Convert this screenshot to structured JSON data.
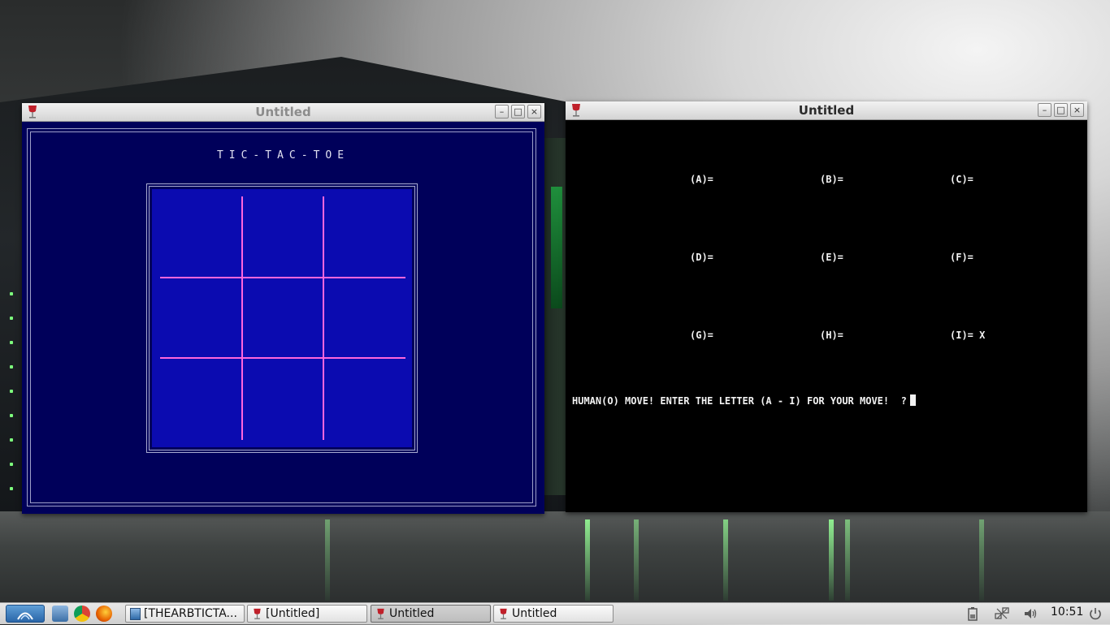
{
  "game_window": {
    "title": "Untitled",
    "heading": "TIC-TAC-TOE",
    "buttons": {
      "minimize": "–",
      "maximize": "□",
      "close": "×"
    }
  },
  "console_window": {
    "title": "Untitled",
    "buttons": {
      "minimize": "–",
      "maximize": "□",
      "close": "×"
    },
    "cells": [
      {
        "label": "(A)=",
        "value": ""
      },
      {
        "label": "(B)=",
        "value": ""
      },
      {
        "label": "(C)=",
        "value": ""
      },
      {
        "label": "(D)=",
        "value": ""
      },
      {
        "label": "(E)=",
        "value": ""
      },
      {
        "label": "(F)=",
        "value": ""
      },
      {
        "label": "(G)=",
        "value": ""
      },
      {
        "label": "(H)=",
        "value": ""
      },
      {
        "label": "(I)=",
        "value": "X"
      }
    ],
    "prompt": "HUMAN(O) MOVE! ENTER THE LETTER (A - I) FOR YOUR MOVE!  ?"
  },
  "taskbar": {
    "tasks": [
      {
        "label": "[THEARBTICTA...",
        "icon": "window-icon"
      },
      {
        "label": "[Untitled]",
        "icon": "wine-icon"
      },
      {
        "label": "Untitled",
        "icon": "wine-icon"
      },
      {
        "label": "Untitled",
        "icon": "wine-icon"
      }
    ],
    "clock": "10:51"
  },
  "colors": {
    "game_background": "#00005a",
    "board_fill": "#0b0bb0",
    "grid_lines": "#ff66dd",
    "console_background": "#000000",
    "console_text": "#f2f2f2"
  }
}
